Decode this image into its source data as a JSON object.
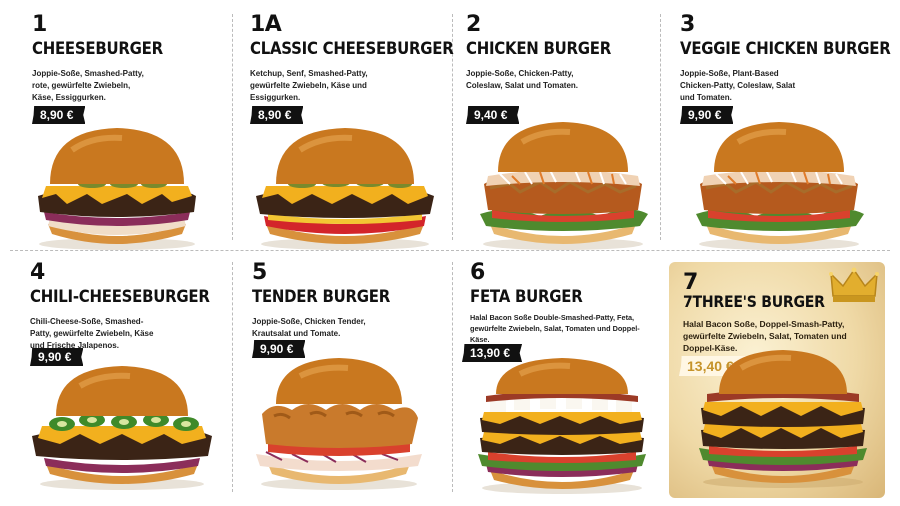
{
  "items": [
    {
      "number": "1",
      "name": "CHEESEBURGER",
      "description": "Joppie-Soße, Smashed-Patty, rote, gewürfelte Zwiebeln, Käse, Essiggurken.",
      "price": "8,90 €"
    },
    {
      "number": "1A",
      "name": "CLASSIC CHEESEBURGER",
      "description": "Ketchup, Senf, Smashed-Patty, gewürfelte Zwiebeln, Käse und Essiggurken.",
      "price": "8,90 €"
    },
    {
      "number": "2",
      "name": "CHICKEN BURGER",
      "description": "Joppie-Soße, Chicken-Patty, Coleslaw, Salat und Tomaten.",
      "price": "9,40 €"
    },
    {
      "number": "3",
      "name": "VEGGIE CHICKEN BURGER",
      "description": "Joppie-Soße, Plant-Based Chicken-Patty, Coleslaw, Salat und Tomaten.",
      "price": "9,90 €"
    },
    {
      "number": "4",
      "name": "CHILI-CHEESEBURGER",
      "description": "Chili-Cheese-Soße, Smashed-Patty, gewürfelte Zwiebeln, Käse und Frische Jalapenos.",
      "price": "9,90 €"
    },
    {
      "number": "5",
      "name": "TENDER BURGER",
      "description": "Joppie-Soße, Chicken Tender, Krautsalat und Tomate.",
      "price": "9,90 €"
    },
    {
      "number": "6",
      "name": "FETA BURGER",
      "description": "Halal Bacon Soße Double-Smashed-Patty, Feta, gewürfelte Zwiebeln, Salat, Tomaten und Doppel-Käse.",
      "price": "13,90 €"
    },
    {
      "number": "7",
      "name": "7THREE'S BURGER",
      "description": "Halal Bacon Soße, Doppel-Smash-Patty, gewürfelte Zwiebeln, Salat, Tomaten und Doppel-Käse.",
      "price": "13,40 €"
    }
  ],
  "colors": {
    "price_tag": "#111111",
    "gold_card": "#efd9a6",
    "gold_price_text": "#c6942b",
    "bun": "#c9781f",
    "patty": "#3b2416",
    "cheese": "#f2b01e"
  },
  "icons": {
    "crown": "crown-icon"
  }
}
